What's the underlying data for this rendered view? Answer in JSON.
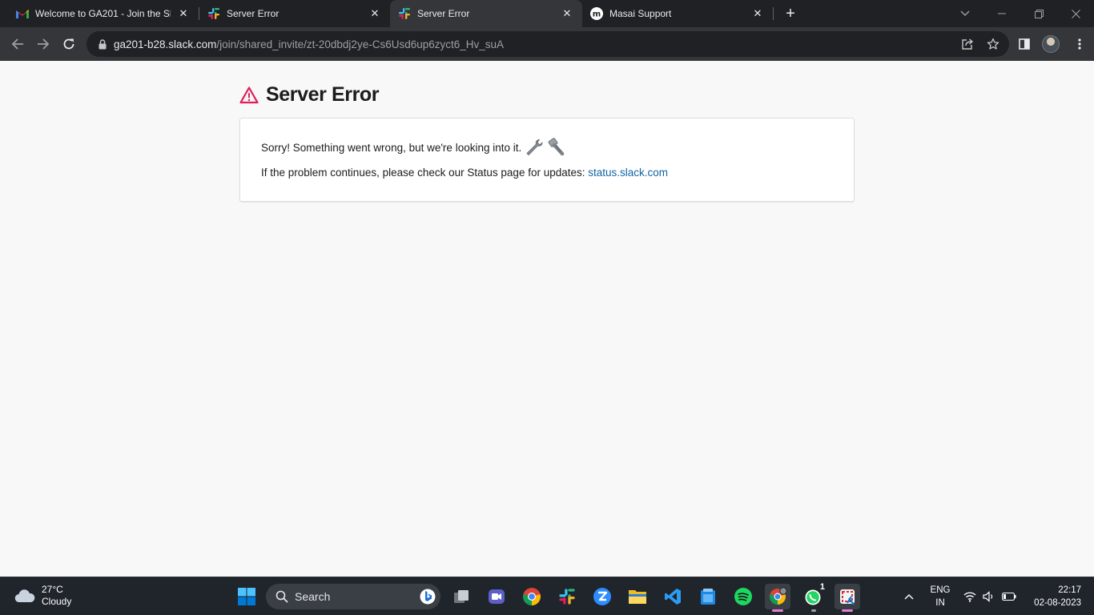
{
  "browser": {
    "tabs": [
      {
        "title": "Welcome to GA201 - Join the Sla",
        "favicon": "gmail-icon",
        "active": false
      },
      {
        "title": "Server Error",
        "favicon": "slack-icon",
        "active": false
      },
      {
        "title": "Server Error",
        "favicon": "slack-icon",
        "active": true
      },
      {
        "title": "Masai Support",
        "favicon": "masai-icon",
        "active": false
      }
    ],
    "new_tab_label": "+",
    "url": {
      "host": "ga201-b28.slack.com",
      "path": "/join/shared_invite/zt-20dbdj2ye-Cs6Usd6up6zyct6_Hv_suA"
    },
    "tab_close_glyph": "✕"
  },
  "page": {
    "title": "Server Error",
    "message": "Sorry! Something went wrong, but we're looking into it.",
    "status_text": "If the problem continues, please check our Status page for updates: ",
    "status_link": "status.slack.com"
  },
  "taskbar": {
    "weather_temp": "27°C",
    "weather_desc": "Cloudy",
    "search_placeholder": "Search",
    "whatsapp_badge": "1",
    "language": "ENG",
    "region": "IN",
    "time": "22:17",
    "date": "02-08-2023"
  },
  "colors": {
    "slack_error_red": "#e01e5a",
    "link_blue": "#1264a3",
    "chrome_dark": "#202124",
    "chrome_toolbar": "#35363a",
    "taskbar_bg": "#20242b"
  }
}
